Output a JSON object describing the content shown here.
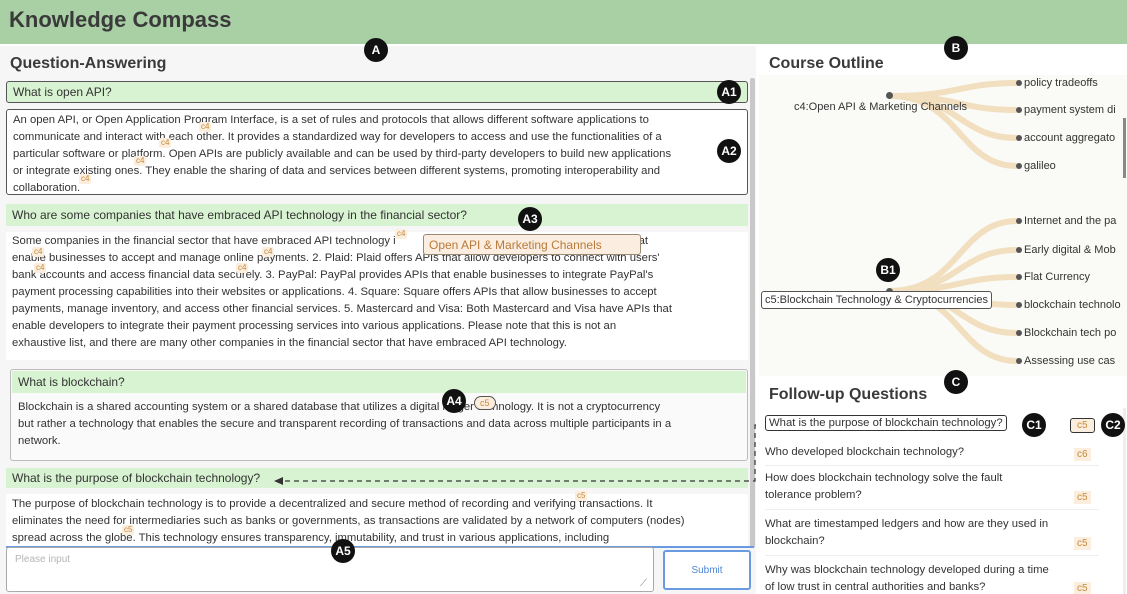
{
  "app": {
    "title": "Knowledge Compass"
  },
  "markers": {
    "A": "A",
    "A1": "A1",
    "A2": "A2",
    "A3": "A3",
    "A4": "A4",
    "A5": "A5",
    "B": "B",
    "B1": "B1",
    "C": "C",
    "C1": "C1",
    "C2": "C2"
  },
  "qa": {
    "title": "Question-Answering",
    "items": [
      {
        "question": "What is open API?",
        "answer_lines": [
          "An open API, or Open Application Program Interface, is a set of rules and protocols that allows different software applications to",
          "communicate and interact with each other. It provides a standardized way for developers to access and use the functionalities of a",
          "particular software or platform. Open APIs are publicly available and can be used by third-party developers to build new applications",
          "or integrate existing ones. They enable the sharing of data and services between different systems, promoting interoperability and",
          "collaboration."
        ]
      },
      {
        "question": "Who are some companies that have embraced API technology in the financial sector?",
        "answer_lines": [
          "Some companies in the financial sector that have embraced API technology i                                                              of APIs that",
          "enable businesses to accept and manage online payments. 2. Plaid: Plaid offers APIs that allow developers to connect with users'",
          "bank accounts and access financial data securely. 3. PayPal: PayPal provides APIs that enable businesses to integrate PayPal's",
          "payment processing capabilities into their websites or applications. 4. Square: Square offers APIs that allow businesses to accept",
          "payments, manage inventory, and access other financial services. 5. Mastercard and Visa: Both Mastercard and Visa have APIs that",
          "enable developers to integrate their payment processing services into various applications. Please note that this is not an",
          "exhaustive list, and there are many other companies in the financial sector that have embraced API technology."
        ],
        "tooltip": "Open API & Marketing Channels"
      },
      {
        "question": "What is blockchain?",
        "answer_lines": [
          "Blockchain is a shared accounting system or a shared database that utilizes a digital ledger technology. It is not a cryptocurrency",
          "but rather a technology that enables the secure and transparent recording of transactions and data across multiple participants in a",
          "network."
        ],
        "pill_tag": "c5"
      },
      {
        "question": "What is the purpose of blockchain technology?",
        "answer_lines": [
          "The purpose of blockchain technology is to provide a decentralized and secure method of recording and verifying transactions. It",
          "eliminates the need for intermediaries such as banks or governments, as transactions are validated by a network of computers (nodes)",
          "spread across the globe. This technology ensures transparency, immutability, and trust in various applications, including"
        ]
      }
    ],
    "inline_tags": [
      "c4",
      "c4",
      "c4",
      "c4",
      "c4",
      "c4",
      "c4",
      "c4",
      "c4",
      "c5",
      "c5"
    ],
    "input": {
      "placeholder": "Please input"
    },
    "submit_label": "Submit"
  },
  "outline": {
    "title": "Course Outline",
    "chapters": [
      {
        "label": "c4:Open API & Marketing Channels",
        "leaves": [
          "policy tradeoffs",
          "payment system di",
          "account aggregato",
          "galileo"
        ]
      },
      {
        "label": "c5:Blockchain Technology & Cryptocurrencies",
        "leaves": [
          "Internet and the pa",
          "Early digital & Mob",
          "Flat Currency",
          "blockchain technolo",
          "Blockchain tech po",
          "Assessing use cas"
        ]
      }
    ]
  },
  "followup": {
    "title": "Follow-up Questions",
    "items": [
      {
        "lines": [
          "What is the purpose of blockchain technology?"
        ],
        "tag": "c5"
      },
      {
        "lines": [
          "Who developed blockchain technology?"
        ],
        "tag": "c6"
      },
      {
        "lines": [
          "How does blockchain technology solve the fault",
          "tolerance problem?"
        ],
        "tag": "c5"
      },
      {
        "lines": [
          "What are timestamped ledgers and how are they used in",
          "blockchain?"
        ],
        "tag": "c5"
      },
      {
        "lines": [
          "Why was blockchain technology developed during a time",
          "of low trust in central authorities and banks?"
        ],
        "tag": "c5"
      }
    ]
  },
  "colors": {
    "header_bg": "#a9cfa4",
    "question_bg": "#d8f3d2",
    "tag_text": "#c78a3a",
    "tag_bg": "#fbeede",
    "branch": "#f3e2c4",
    "submit_border": "#6a9be0"
  }
}
